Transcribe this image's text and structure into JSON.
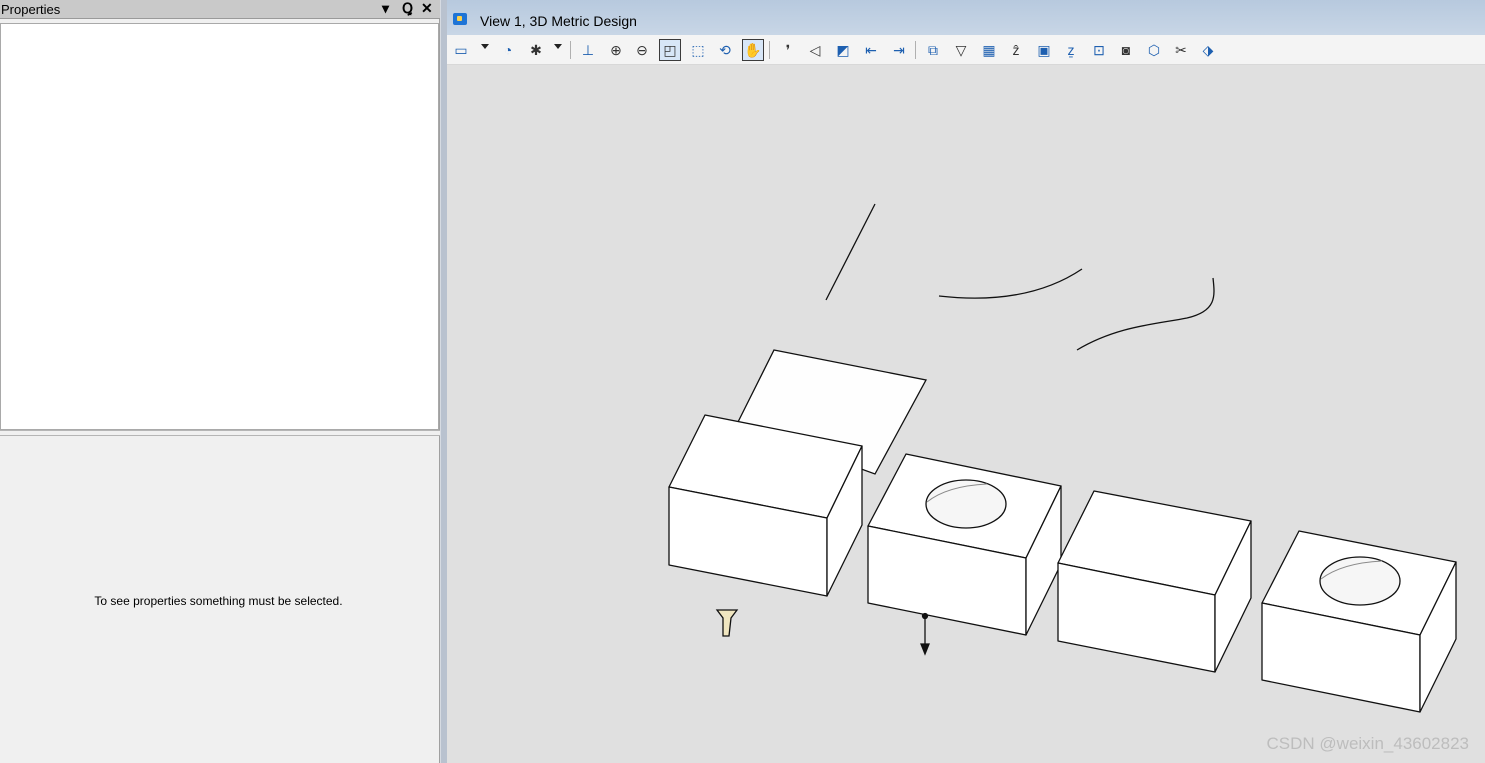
{
  "properties_panel": {
    "title": "Properties",
    "controls": {
      "menu": "▾",
      "pin": "Ꝗ",
      "close": "✕"
    },
    "empty_message": "To see properties something must be selected."
  },
  "view": {
    "title": "View 1, 3D Metric Design",
    "toolbar_icons": [
      "view-attributes-icon",
      "levels-icon",
      "display-style-icon",
      "update-view-icon",
      "zoom-in-icon",
      "zoom-out-icon",
      "window-area-icon",
      "fit-view-icon",
      "rotate-view-icon",
      "pan-view-icon",
      "walk-icon",
      "view-previous-icon",
      "view-next-icon",
      "copy-view-icon",
      "clip-volume-icon",
      "camera-icon",
      "toggle-3d-icon"
    ]
  },
  "watermark": "CSDN @weixin_43602823",
  "colors": {
    "view_background": "#e0e0e0",
    "title_bar": "#b7c9de",
    "panel_background": "#f0f0f0"
  }
}
